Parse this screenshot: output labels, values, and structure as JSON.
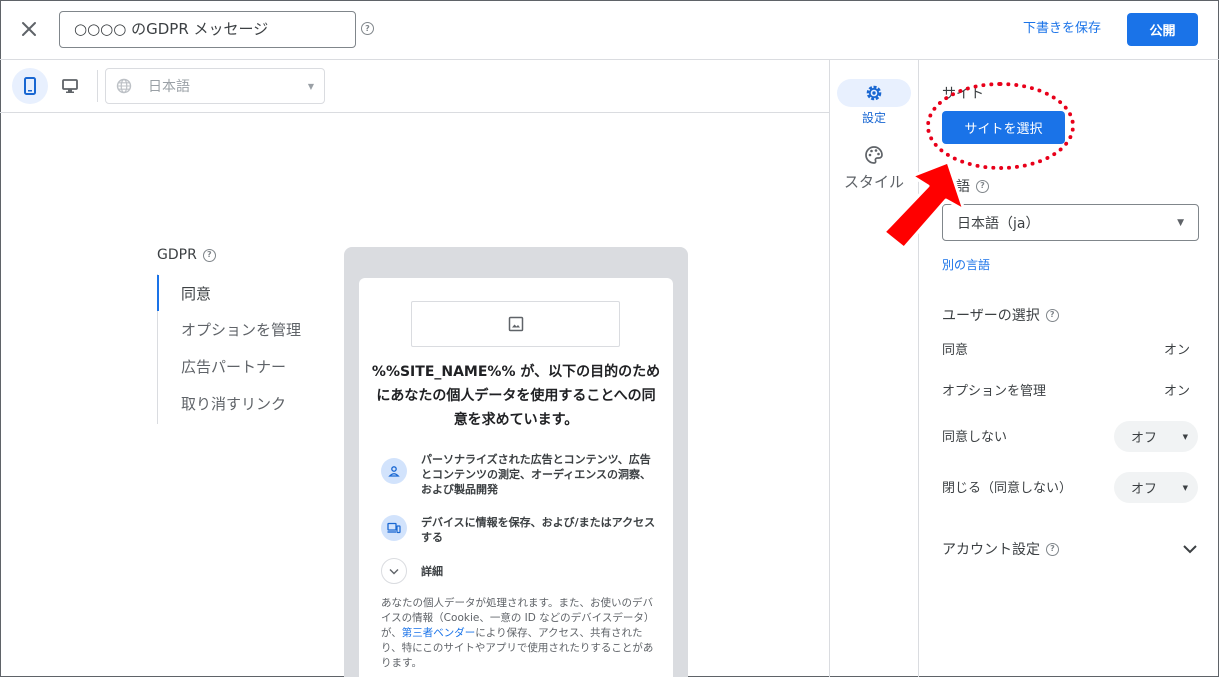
{
  "header": {
    "title_value": "○○○○ のGDPR メッセージ",
    "save_draft_label": "下書きを保存",
    "publish_label": "公開"
  },
  "preview_toolbar": {
    "language_placeholder": "日本語"
  },
  "left_nav": {
    "heading": "GDPR",
    "items": [
      {
        "label": "同意"
      },
      {
        "label": "オプションを管理"
      },
      {
        "label": "広告パートナー"
      },
      {
        "label": "取り消すリンク"
      }
    ]
  },
  "preview_card": {
    "title": "%%SITE_NAME%% が、以下の目的のためにあなたの個人データを使用することへの同意を求めています。",
    "purposes": [
      {
        "text": "パーソナライズされた広告とコンテンツ、広告とコンテンツの測定、オーディエンスの洞察、および製品開発",
        "icon": "person-icon"
      },
      {
        "text": "デバイスに情報を保存、および/またはアクセスする",
        "icon": "devices-icon"
      }
    ],
    "details_label": "詳細",
    "body_before_link": "あなたの個人データが処理されます。また、お使いのデバイスの情報（Cookie、一意の ID などのデバイスデータ）が、",
    "body_link": "第三者ベンダー",
    "body_after_link": "により保存、アクセス、共有されたり、特にこのサイトやアプリで使用されたりすることがあります。"
  },
  "side_tabs": [
    {
      "label": "設定",
      "icon": "gear-icon",
      "active": true
    },
    {
      "label": "スタイル",
      "icon": "palette-icon",
      "active": false
    }
  ],
  "settings": {
    "site_label": "サイト",
    "select_site_label": "サイトを選択",
    "language_label": "言語",
    "language_value": "日本語（ja）",
    "other_language_label": "別の言語",
    "user_choice_label": "ユーザーの選択",
    "choices": [
      {
        "label": "同意",
        "value": "オン"
      },
      {
        "label": "オプションを管理",
        "value": "オン"
      },
      {
        "label": "同意しない",
        "value": "オフ"
      },
      {
        "label": "閉じる（同意しない）",
        "value": "オフ"
      }
    ],
    "account_settings_label": "アカウント設定"
  },
  "colors": {
    "accent": "#1a73e8",
    "annotation": "#e8001a"
  }
}
